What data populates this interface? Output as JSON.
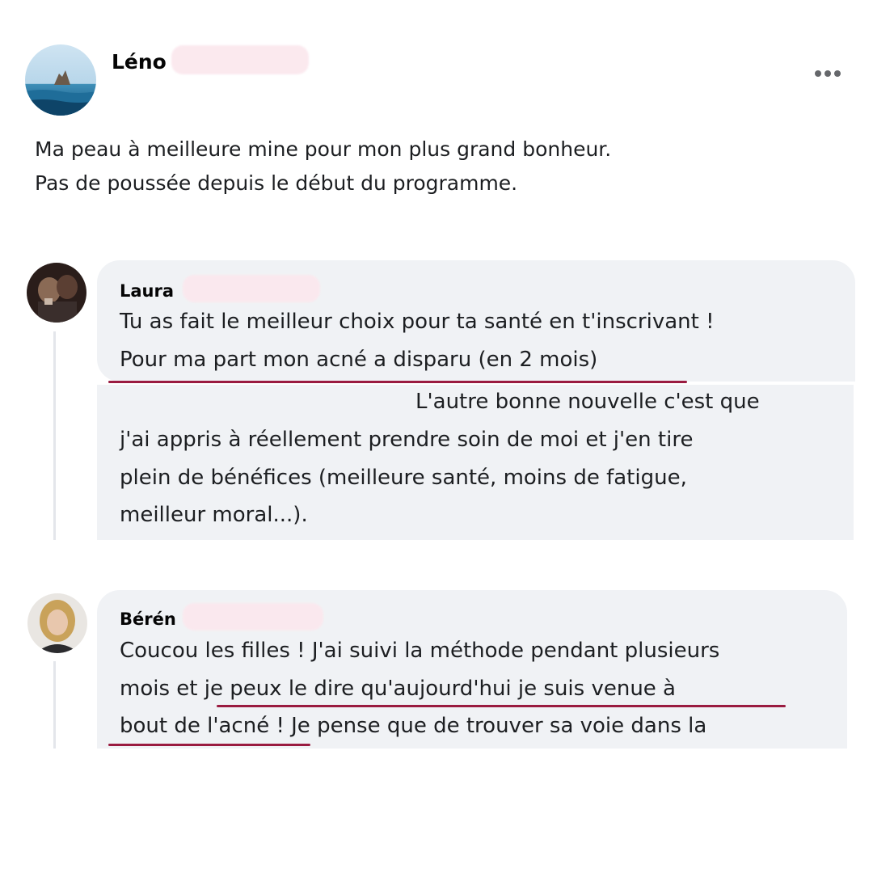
{
  "post": {
    "author": "Léno",
    "text_lines": [
      "Ma peau à meilleure mine pour mon plus grand bonheur.",
      "Pas de poussée depuis le début du programme."
    ],
    "more_icon": "more-horizontal-icon"
  },
  "comments": [
    {
      "author": "Laura",
      "lines": [
        "Tu as fait le meilleur choix pour ta santé en t'inscrivant !",
        "Pour ma part mon acné a disparu (en 2 mois)",
        "L'autre bonne nouvelle c'est que",
        "j'ai appris à réellement prendre soin de moi et j'en tire",
        "plein de bénéfices (meilleure santé, moins de fatigue,",
        "meilleur moral...)."
      ]
    },
    {
      "author": "Bérén",
      "lines": [
        "Coucou les filles ! J'ai suivi la méthode pendant plusieurs",
        "mois et je peux le dire qu'aujourd'hui je suis venue à",
        "bout de l'acné ! Je pense que de trouver sa voie dans la"
      ]
    }
  ],
  "colors": {
    "bubble": "#f0f2f5",
    "underline": "#9a1b40",
    "redaction": "#fbe8ee"
  }
}
